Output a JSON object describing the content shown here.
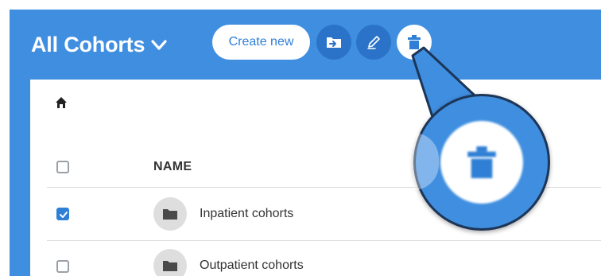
{
  "header": {
    "title": "All Cohorts",
    "create_button_label": "Create new",
    "icons": [
      "move-folder-icon",
      "rename-pen-icon",
      "trash-icon"
    ]
  },
  "table": {
    "columns": [
      "NAME"
    ],
    "rows": [
      {
        "label": "Inpatient cohorts",
        "checked": true
      },
      {
        "label": "Outpatient cohorts",
        "checked": false
      }
    ]
  },
  "colors": {
    "header_blue": "#3f8ee0",
    "dark_blue": "#2a73c9",
    "accent_blue": "#2f7fd6",
    "magnifier_border": "#1d3557"
  },
  "callout": {
    "icon": "trash-icon",
    "state": "highlighted"
  }
}
